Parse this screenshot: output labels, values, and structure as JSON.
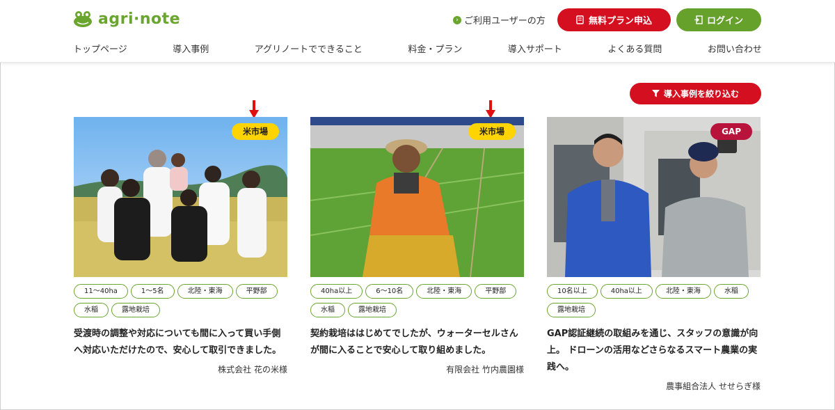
{
  "header": {
    "logo_text": "agri·note",
    "user_link": "ご利用ユーザーの方",
    "signup_label": "無料プラン申込",
    "login_label": "ログイン"
  },
  "nav": {
    "items": [
      "トップページ",
      "導入事例",
      "アグリノートでできること",
      "料金・プラン",
      "導入サポート",
      "よくある質問",
      "お問い合わせ"
    ]
  },
  "filter": {
    "label": "導入事例を絞り込む"
  },
  "cases": [
    {
      "badge": "米市場",
      "tags": [
        "11〜40ha",
        "1〜5名",
        "北陸・東海",
        "平野部",
        "水稲",
        "露地栽培"
      ],
      "description": "受渡時の調整や対応についても間に入って買い手側へ対応いただけたので、安心して取引できました。",
      "company": "株式会社 花の米様"
    },
    {
      "badge": "米市場",
      "tags": [
        "40ha以上",
        "6〜10名",
        "北陸・東海",
        "平野部",
        "水稲",
        "露地栽培"
      ],
      "description": "契約栽培ははじめてでしたが、ウォーターセルさんが間に入ることで安心して取り組めました。",
      "company": "有限会社 竹内農園様"
    },
    {
      "badge": "GAP",
      "tags": [
        "10名以上",
        "40ha以上",
        "北陸・東海",
        "水稲",
        "露地栽培"
      ],
      "description": "GAP認証継続の取組みを通じ、スタッフの意識が向上。 ドローンの活用などさらなるスマート農業の実践へ。",
      "company": "農事組合法人 せせらぎ様"
    }
  ],
  "colors": {
    "brand_green": "#6aa52e",
    "signup_red": "#d40f1f",
    "badge_yellow": "#ffd400",
    "badge_gap": "#b8133a"
  }
}
